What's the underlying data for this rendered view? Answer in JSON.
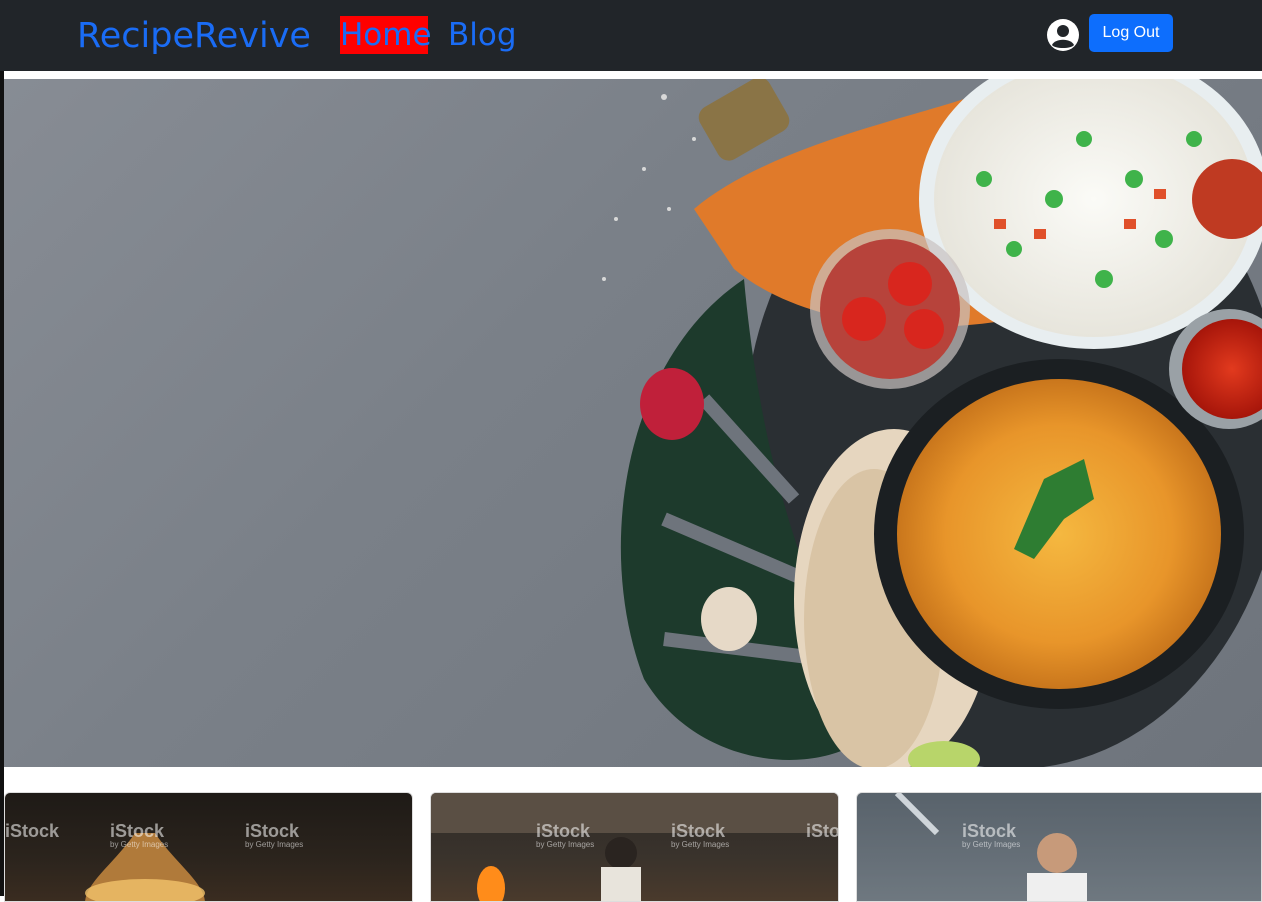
{
  "header": {
    "brand": "RecipeRevive",
    "nav": [
      {
        "label": "Home",
        "active": true
      },
      {
        "label": "Blog",
        "active": false
      }
    ],
    "user_icon": "user-circle-icon",
    "logout_label": "Log Out"
  },
  "colors": {
    "navbar_bg": "#212529",
    "brand": "#1a6cf5",
    "active_nav_bg": "#ff0000",
    "button": "#0d6efd"
  },
  "hero": {
    "image": "Indian food spread: dal curry, vegetable rice, flatbread, tomatoes, chili on grey stone"
  },
  "cards": [
    {
      "image": "restaurant kitchen with lamp",
      "watermark": "iStock",
      "watermark_sub": "by Getty Images"
    },
    {
      "image": "chefs cooking with flames",
      "watermark": "iStock",
      "watermark_sub": "by Getty Images"
    },
    {
      "image": "chef in stainless kitchen",
      "watermark": "iStock",
      "watermark_sub": "by Getty Images"
    }
  ]
}
